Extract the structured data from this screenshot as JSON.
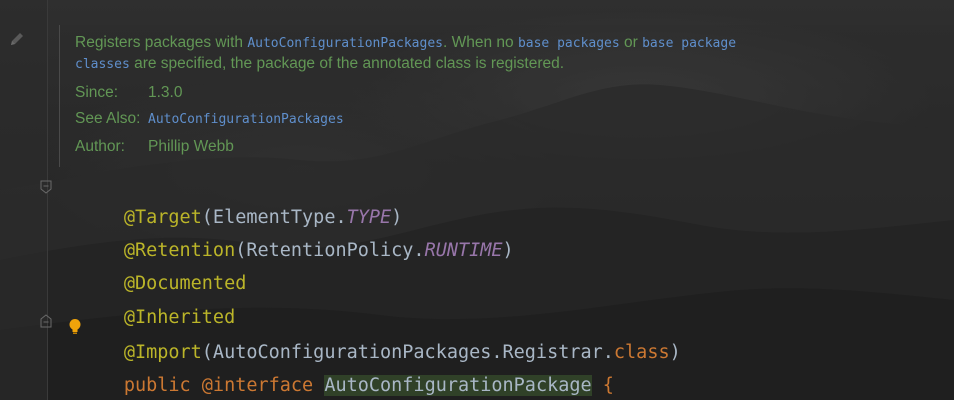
{
  "doc": {
    "registers": {
      "t1": "Registers packages with ",
      "c1": "AutoConfigurationPackages",
      "t2": ". When no ",
      "c2": "base packages",
      "t3": " or ",
      "c3": "base package",
      "c4": "classes",
      "t4": " are specified, the package of the annotated class is registered."
    },
    "since": {
      "tag": "Since:",
      "value": "1.3.0"
    },
    "see_also": {
      "tag": "See Also:",
      "value": "AutoConfigurationPackages"
    },
    "author": {
      "tag": "Author:",
      "value": "Phillip Webb"
    }
  },
  "code": {
    "l1": {
      "ann": "@Target",
      "p1": "(ElementType.",
      "const": "TYPE",
      "p2": ")"
    },
    "l2": {
      "ann": "@Retention",
      "p1": "(RetentionPolicy.",
      "const": "RUNTIME",
      "p2": ")"
    },
    "l3": {
      "ann": "@Documented"
    },
    "l4": {
      "ann": "@Inherited"
    },
    "l5": {
      "ann": "@Import",
      "p1": "(AutoConfigurationPackages.Registrar.",
      "kw": "class",
      "p2": ")"
    },
    "l6": {
      "kw1": "public",
      "sp1": " ",
      "ann": "@interface",
      "sp2": " ",
      "name": "AutoConfigurationPackage",
      "brace": " {"
    }
  },
  "colors": {
    "background": "#2b2b2b",
    "doc_text": "#629755",
    "doc_code": "#5f8fcc",
    "annotation": "#bbb529",
    "keyword": "#cc7832",
    "constant": "#9876aa",
    "plain": "#a9b7c6"
  },
  "icons": [
    "pencil-icon",
    "fold-marker-icon",
    "lightbulb-icon"
  ]
}
